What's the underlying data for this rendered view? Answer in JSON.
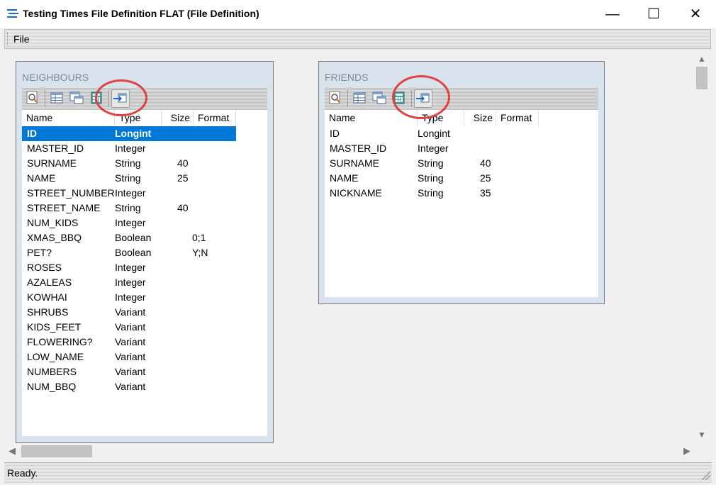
{
  "window": {
    "title": "Testing Times File Definition FLAT (File Definition)",
    "min_glyph": "—",
    "max_glyph": "☐",
    "close_glyph": "✕"
  },
  "menu": {
    "file": "File"
  },
  "status": {
    "text": "Ready."
  },
  "colors": {
    "selection": "#0078d7",
    "annotation": "#e0403f"
  },
  "neighbours": {
    "title": "NEIGHBOURS",
    "columns": [
      "Name",
      "Type",
      "Size",
      "Format"
    ],
    "rows": [
      {
        "name": "ID",
        "type": "Longint",
        "size": "",
        "format": ""
      },
      {
        "name": "MASTER_ID",
        "type": "Integer",
        "size": "",
        "format": ""
      },
      {
        "name": "SURNAME",
        "type": "String",
        "size": "40",
        "format": ""
      },
      {
        "name": "NAME",
        "type": "String",
        "size": "25",
        "format": ""
      },
      {
        "name": "STREET_NUMBER",
        "type": "Integer",
        "size": "",
        "format": ""
      },
      {
        "name": "STREET_NAME",
        "type": "String",
        "size": "40",
        "format": ""
      },
      {
        "name": "NUM_KIDS",
        "type": "Integer",
        "size": "",
        "format": ""
      },
      {
        "name": "XMAS_BBQ",
        "type": "Boolean",
        "size": "",
        "format": "0;1"
      },
      {
        "name": "PET?",
        "type": "Boolean",
        "size": "",
        "format": "Y;N"
      },
      {
        "name": "ROSES",
        "type": "Integer",
        "size": "",
        "format": ""
      },
      {
        "name": "AZALEAS",
        "type": "Integer",
        "size": "",
        "format": ""
      },
      {
        "name": "KOWHAI",
        "type": "Integer",
        "size": "",
        "format": ""
      },
      {
        "name": "SHRUBS",
        "type": "Variant",
        "size": "",
        "format": ""
      },
      {
        "name": "KIDS_FEET",
        "type": "Variant",
        "size": "",
        "format": ""
      },
      {
        "name": "FLOWERING?",
        "type": "Variant",
        "size": "",
        "format": ""
      },
      {
        "name": "LOW_NAME",
        "type": "Variant",
        "size": "",
        "format": ""
      },
      {
        "name": "NUMBERS",
        "type": "Variant",
        "size": "",
        "format": ""
      },
      {
        "name": "NUM_BBQ",
        "type": "Variant",
        "size": "",
        "format": ""
      }
    ]
  },
  "friends": {
    "title": "FRIENDS",
    "columns": [
      "Name",
      "Type",
      "Size",
      "Format"
    ],
    "rows": [
      {
        "name": "ID",
        "type": "Longint",
        "size": "",
        "format": ""
      },
      {
        "name": "MASTER_ID",
        "type": "Integer",
        "size": "",
        "format": ""
      },
      {
        "name": "SURNAME",
        "type": "String",
        "size": "40",
        "format": ""
      },
      {
        "name": "NAME",
        "type": "String",
        "size": "25",
        "format": ""
      },
      {
        "name": "NICKNAME",
        "type": "String",
        "size": "35",
        "format": ""
      }
    ]
  }
}
